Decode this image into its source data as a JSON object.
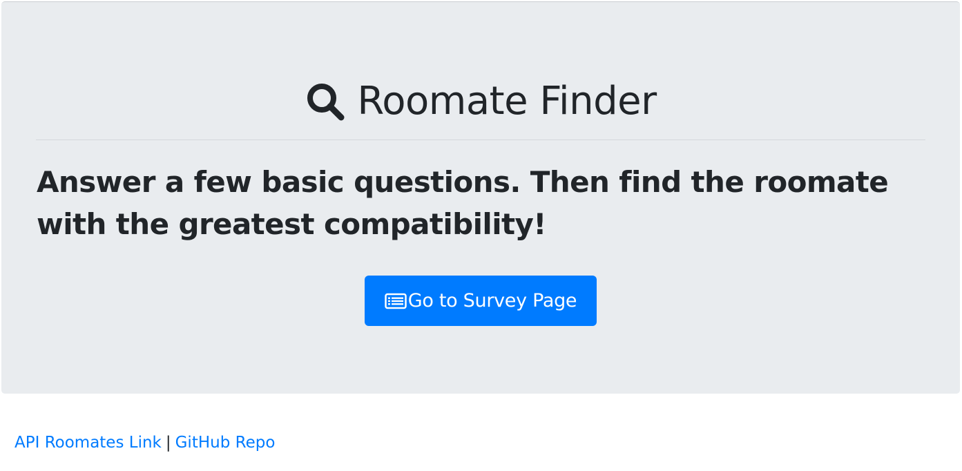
{
  "header": {
    "title": "Roomate Finder",
    "title_icon": "search-icon"
  },
  "main": {
    "lead": "Answer a few basic questions. Then find the roomate with the greatest compatibility!",
    "cta_label": "Go to Survey Page",
    "cta_icon": "list-alt-icon"
  },
  "footer": {
    "api_link_label": "API Roomates Link",
    "separator": "|",
    "github_link_label": "GitHub Repo"
  },
  "colors": {
    "jumbotron_bg": "#e9ecef",
    "primary": "#007bff",
    "text": "#212529"
  }
}
